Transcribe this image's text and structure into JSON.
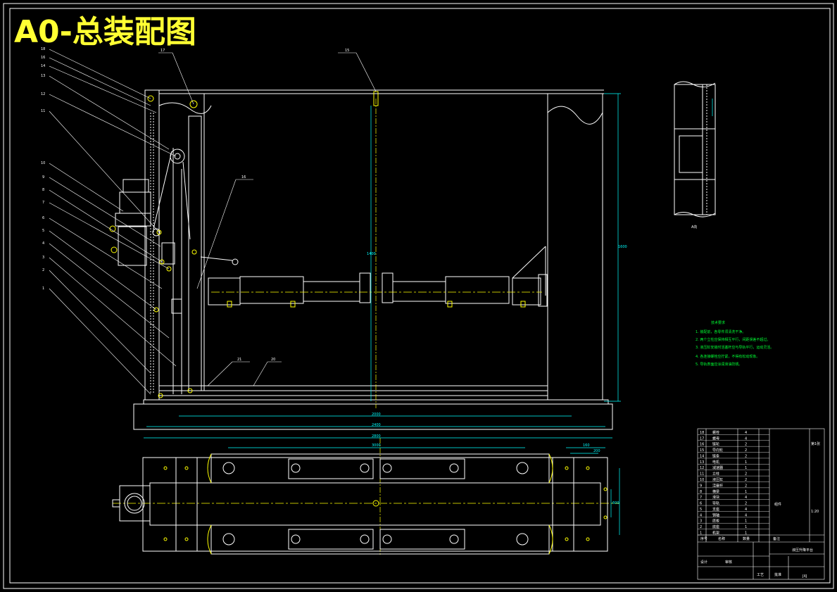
{
  "drawing": {
    "title": "A0-总装配图",
    "detail_label": "A向",
    "colors": {
      "background": "#000000",
      "frame": "#ffffff",
      "title": "#ffff33",
      "leader": "#ffffff",
      "center_line": "#ffff00",
      "dimension": "#00ffff",
      "notes": "#00ff33"
    }
  },
  "part_balloons": {
    "left_upper": [
      "18",
      "16",
      "14",
      "13",
      "12",
      "11"
    ],
    "left_lower": [
      "10",
      "9",
      "8",
      "7",
      "6",
      "5",
      "4",
      "3",
      "2",
      "1"
    ],
    "top": [
      "17",
      "15"
    ],
    "mid": [
      "16"
    ],
    "bottom": [
      "21",
      "20"
    ]
  },
  "dimensions": {
    "overall_height_1": "1600",
    "overall_height_2": "1400",
    "width_1": "2000",
    "width_2": "2400",
    "width_3": "2800",
    "plan_width": "3000",
    "plan_side_1": "160",
    "plan_side_2": "200",
    "plan_depth": "600"
  },
  "notes": {
    "heading": "技术要求",
    "items": [
      "1. 装配前，各零件须清洗干净。",
      "2. 两个立柱应保持相互平行，间距误差不超过。",
      "3. 液压缸安装时活塞杆应与导轨平行，运动灵活。",
      "4. 各连接螺栓应拧紧，不得有松动现象。",
      "5. 导轨表面应涂润滑油防锈。"
    ]
  },
  "title_block": {
    "drawing_name": "液压升降平台",
    "scale": "1:20",
    "sheet": "第1张",
    "material": "组件",
    "company": "JXJ",
    "rows": [
      {
        "no": "18",
        "name": "螺栓",
        "qty": "4"
      },
      {
        "no": "17",
        "name": "螺母",
        "qty": "4"
      },
      {
        "no": "16",
        "name": "链轮",
        "qty": "2"
      },
      {
        "no": "15",
        "name": "导向轮",
        "qty": "2"
      },
      {
        "no": "14",
        "name": "链条",
        "qty": "2"
      },
      {
        "no": "13",
        "name": "电机",
        "qty": "1"
      },
      {
        "no": "12",
        "name": "减速器",
        "qty": "1"
      },
      {
        "no": "11",
        "name": "立柱",
        "qty": "2"
      },
      {
        "no": "10",
        "name": "液压缸",
        "qty": "2"
      },
      {
        "no": "9",
        "name": "活塞杆",
        "qty": "2"
      },
      {
        "no": "8",
        "name": "横梁",
        "qty": "1"
      },
      {
        "no": "7",
        "name": "滑块",
        "qty": "4"
      },
      {
        "no": "6",
        "name": "导轨",
        "qty": "2"
      },
      {
        "no": "5",
        "name": "支座",
        "qty": "4"
      },
      {
        "no": "4",
        "name": "销轴",
        "qty": "4"
      },
      {
        "no": "3",
        "name": "底板",
        "qty": "1"
      },
      {
        "no": "2",
        "name": "底座",
        "qty": "1"
      },
      {
        "no": "1",
        "name": "机架",
        "qty": "1"
      }
    ],
    "header": [
      "序号",
      "名称",
      "数量",
      "备注"
    ],
    "footer_labels": [
      "设计",
      "审核",
      "工艺",
      "批准"
    ]
  }
}
